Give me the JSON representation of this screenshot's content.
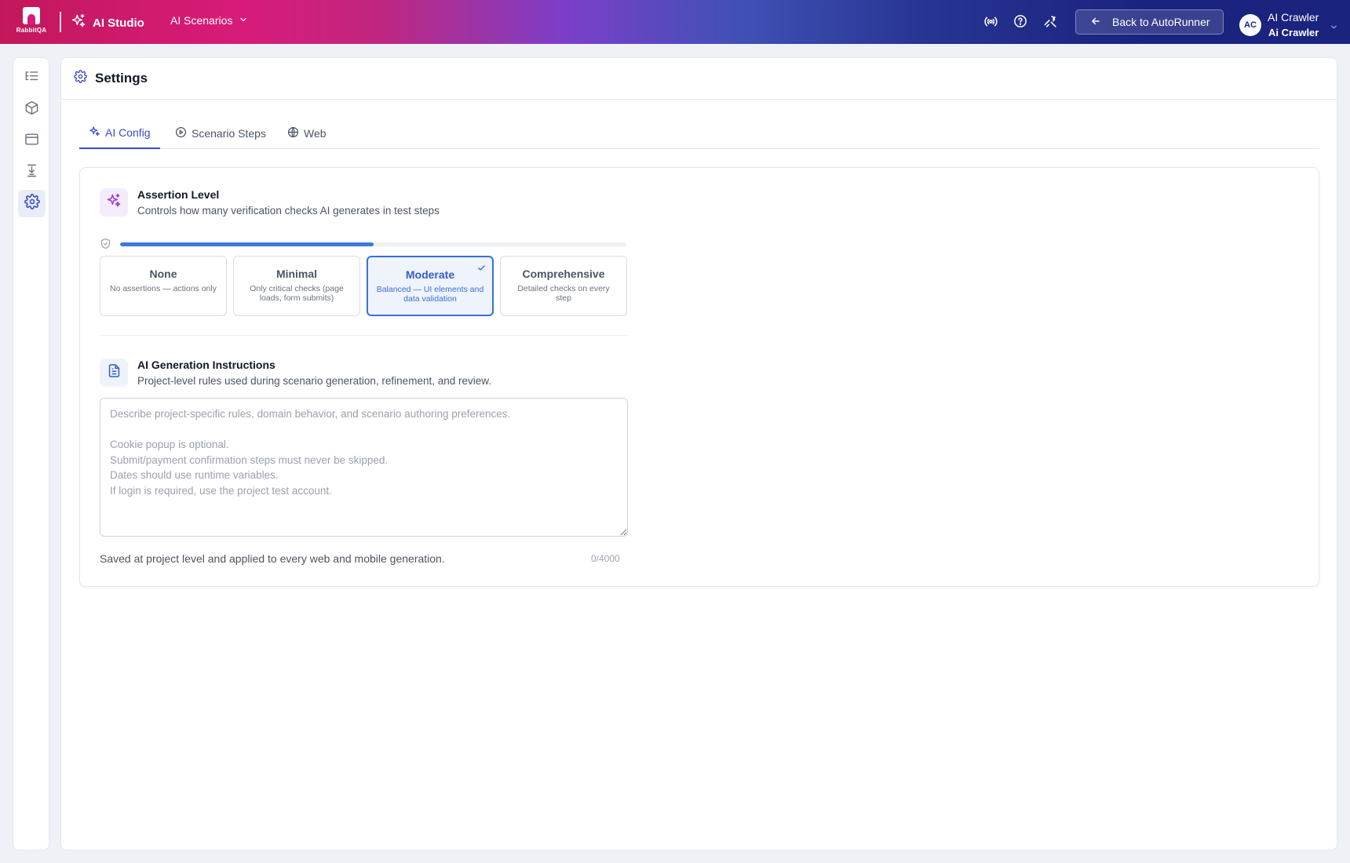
{
  "topbar": {
    "logo_text": "RabbitQA",
    "app_name": "AI Studio",
    "nav_menu": "AI Scenarios",
    "icons": [
      "broadcast-icon",
      "help-icon",
      "tools-icon"
    ],
    "back_button": "Back to AutoRunner",
    "user": {
      "initials": "AC",
      "name": "AI Crawler",
      "subtitle": "Ai Crawler"
    }
  },
  "sidebar": {
    "items": [
      {
        "icon": "list-tree-icon",
        "active": false
      },
      {
        "icon": "cube-icon",
        "active": false
      },
      {
        "icon": "browser-window-icon",
        "active": false
      },
      {
        "icon": "step-into-icon",
        "active": false
      },
      {
        "icon": "gear-icon",
        "active": true
      }
    ]
  },
  "page": {
    "title": "Settings",
    "tabs": [
      {
        "label": "AI Config",
        "active": true
      },
      {
        "label": "Scenario Steps",
        "active": false
      },
      {
        "label": "Web",
        "active": false
      }
    ]
  },
  "assertion": {
    "title": "Assertion Level",
    "subtitle": "Controls how many verification checks AI generates in test steps",
    "progress_fraction": 0.5,
    "options": [
      {
        "name": "None",
        "desc": "No assertions — actions only",
        "selected": false
      },
      {
        "name": "Minimal",
        "desc": "Only critical checks (page loads, form submits)",
        "selected": false
      },
      {
        "name": "Moderate",
        "desc": "Balanced — UI elements and data validation",
        "selected": true
      },
      {
        "name": "Comprehensive",
        "desc": "Detailed checks on every step",
        "selected": false
      }
    ]
  },
  "instructions": {
    "title": "AI Generation Instructions",
    "subtitle": "Project-level rules used during scenario generation, refinement, and review.",
    "value": "",
    "placeholder": "Describe project-specific rules, domain behavior, and scenario authoring preferences.\n\nCookie popup is optional.\nSubmit/payment confirmation steps must never be skipped.\nDates should use runtime variables.\nIf login is required, use the project test account.",
    "help": "Saved at project level and applied to every web and mobile generation.",
    "char_count": "0/4000"
  },
  "colors": {
    "accent": "#3b4bc9",
    "selected_border": "#3a6fd8",
    "progress": "#3a7bd5",
    "sparkle_purple": "#9b3fd1"
  }
}
